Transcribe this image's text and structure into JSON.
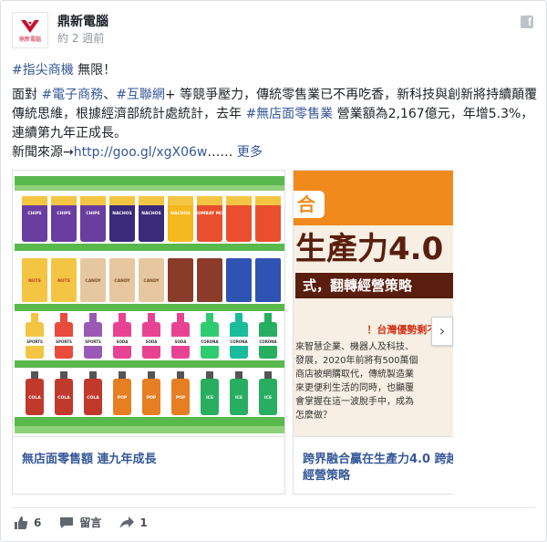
{
  "header": {
    "page_name": "鼎新電腦",
    "timestamp": "約 2 週前",
    "logo_text": "鼎新電腦"
  },
  "post": {
    "line1_tag": "#指尖商機",
    "line1_text": " 無限！",
    "p2_a": "面對 ",
    "p2_tag1": "#電子商務",
    "p2_sep": "、",
    "p2_tag2": "#互聯網",
    "p2_b": "+ 等競爭壓力，傳統零售業已不再吃香，新科技與創新將持續顛覆傳統思維，根據經濟部統計處統計，去年 ",
    "p2_tag3": "#無店面零售業",
    "p2_c": " 營業額為2,167億元，年增5.3%，連續第九年正成長。",
    "source_label": "新聞來源→",
    "source_url": "http://goo.gl/xgX06w",
    "ellipsis": "…… ",
    "more": "更多"
  },
  "carousel": {
    "cards": [
      {
        "title": "無店面零售額 連九年成長"
      },
      {
        "title": "跨界融合贏在生產力4.0 跨越經營策略",
        "banner_tag": "合",
        "banner_main": "生產力4.0",
        "banner_sub": "式，翻轉經營策略",
        "notice": "！台灣優勢剩不到5年！",
        "body_lines": [
          "來智慧企業、機器人及科技、",
          "發展，2020年前將有500萬個",
          "商店被網購取代，傳統製造業",
          "來更便利生活的同時，也顯覆",
          "會掌握在這一波脫手中，成為",
          "怎麼做？"
        ]
      }
    ],
    "products": {
      "row1": [
        "CHIPS",
        "CHIPS",
        "CHIPS",
        "NACHOS",
        "NACHOS",
        "NACHOS",
        "BOMBAY MIX",
        "",
        ""
      ],
      "row2": [
        "NUTS",
        "NUTS",
        "CANDY",
        "CANDY",
        "CANDY",
        "",
        ""
      ],
      "row3": [
        "SPORTS DRINK",
        "SPORTS DRINK",
        "SPORTS DRINK",
        "SODA",
        "SODA",
        "SODA",
        "CORONA",
        "CORONA",
        "CORONA"
      ],
      "row4": [
        "COLA",
        "COLA",
        "COLA",
        "POP",
        "POP",
        "POP",
        "ICE TEA",
        "ICE TEA",
        "ICE TEA"
      ]
    }
  },
  "actions": {
    "like_count": "6",
    "comment_label": "留言",
    "share_count": "1"
  },
  "colors": {
    "brand_red": "#c8102e",
    "link_blue": "#365899",
    "text": "#1d2129",
    "meta_gray": "#90949c",
    "banner_orange": "#f08a1c"
  }
}
